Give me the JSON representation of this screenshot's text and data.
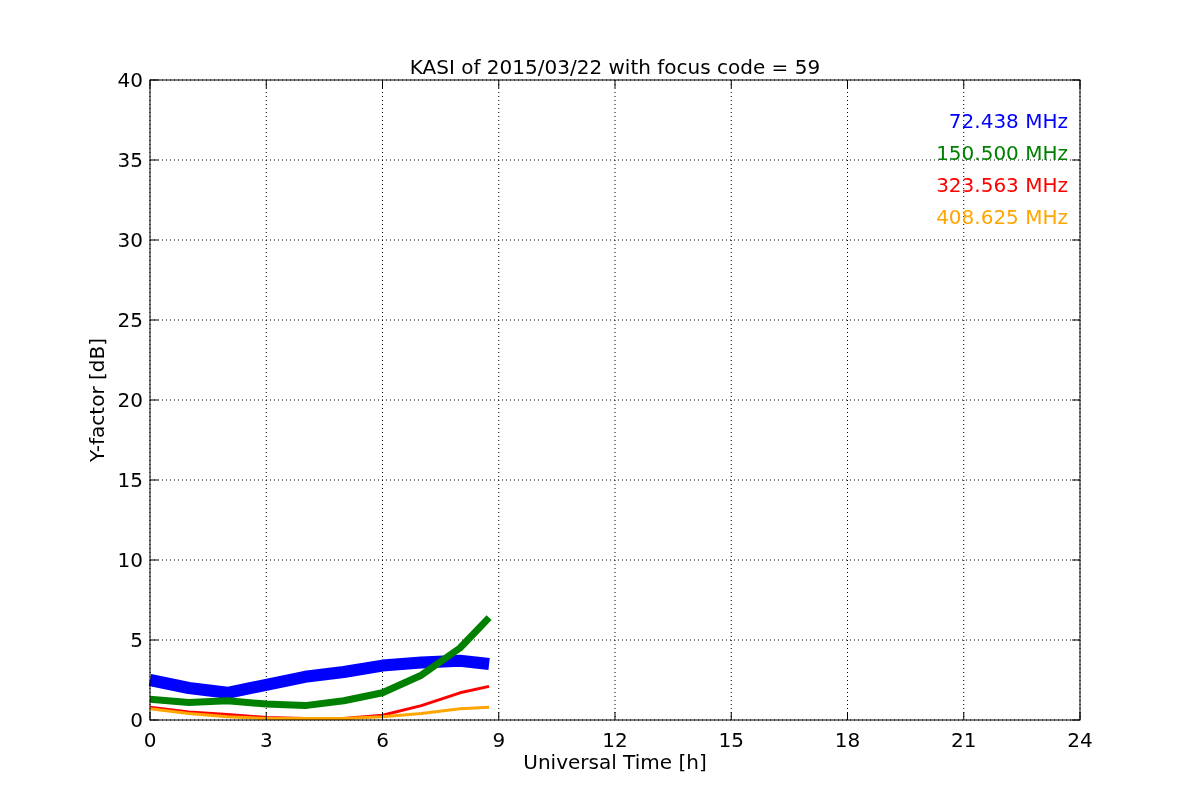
{
  "chart": {
    "chart_data": {
      "type": "line",
      "title": "KASI of 2015/03/22 with focus code = 59",
      "xlabel": "Universal Time [h]",
      "ylabel": "Y-factor [dB]",
      "x": [
        0,
        1,
        2,
        3,
        4,
        5,
        6,
        7,
        8,
        8.75
      ],
      "series": [
        {
          "name": "72.438 MHz",
          "color": "#0000ff",
          "values": [
            2.5,
            2.0,
            1.7,
            2.2,
            2.7,
            3.0,
            3.4,
            3.6,
            3.7,
            3.5
          ]
        },
        {
          "name": "150.500 MHz",
          "color": "#008000",
          "values": [
            1.3,
            1.1,
            1.2,
            1.0,
            0.9,
            1.2,
            1.7,
            2.8,
            4.5,
            6.4
          ]
        },
        {
          "name": "323.563 MHz",
          "color": "#ff0000",
          "values": [
            0.8,
            0.5,
            0.35,
            0.15,
            0.1,
            0.1,
            0.3,
            0.9,
            1.7,
            2.1
          ]
        },
        {
          "name": "408.625 MHz",
          "color": "#ffa500",
          "values": [
            0.7,
            0.4,
            0.2,
            0.1,
            0.1,
            0.1,
            0.2,
            0.4,
            0.7,
            0.8
          ]
        }
      ],
      "xlim": [
        0,
        24
      ],
      "ylim": [
        0,
        40
      ],
      "xticks": [
        0,
        3,
        6,
        9,
        12,
        15,
        18,
        21,
        24
      ],
      "yticks": [
        0,
        5,
        10,
        15,
        20,
        25,
        30,
        35,
        40
      ],
      "grid": true
    }
  }
}
